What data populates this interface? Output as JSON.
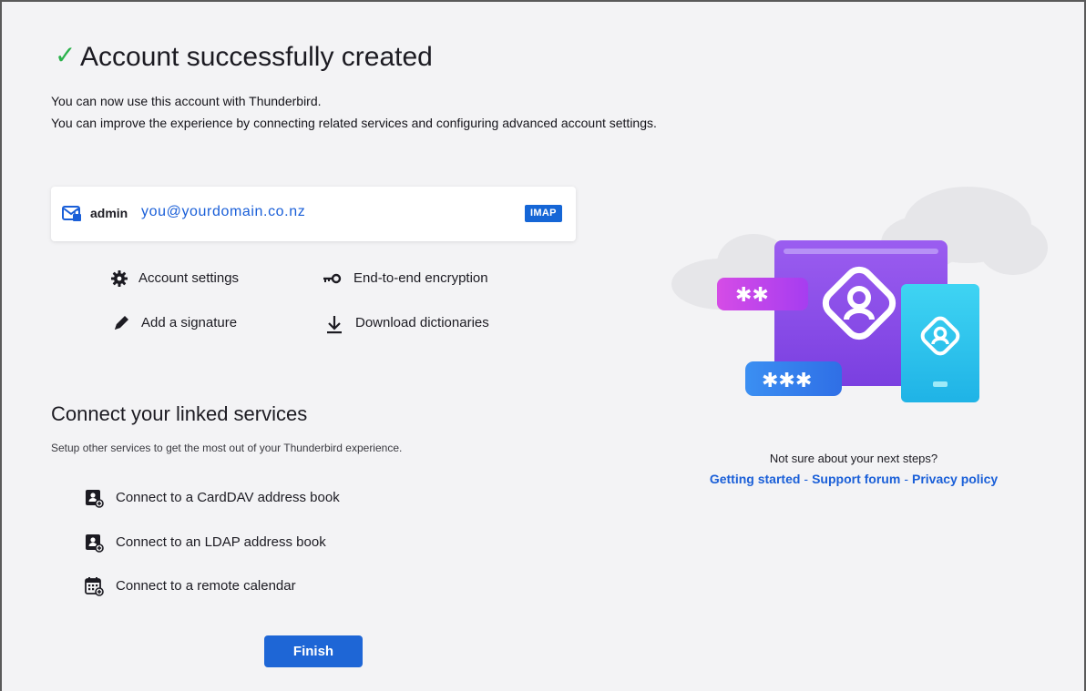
{
  "header": {
    "check_glyph": "✓",
    "title": "Account successfully created",
    "line1": "You can now use this account with Thunderbird.",
    "line2": "You can improve the experience by connecting related services and configuring advanced account settings."
  },
  "account": {
    "name": "admin",
    "email": "you@yourdomain.co.nz",
    "protocol": "IMAP",
    "icon": "mail-icon"
  },
  "actions": [
    {
      "label": "Account settings",
      "icon": "gear-icon"
    },
    {
      "label": "End-to-end encryption",
      "icon": "key-icon"
    },
    {
      "label": "Add a signature",
      "icon": "pen-icon"
    },
    {
      "label": "Download dictionaries",
      "icon": "download-icon"
    }
  ],
  "linked": {
    "title": "Connect your linked services",
    "subtitle": "Setup other services to get the most out of your Thunderbird experience.",
    "services": [
      {
        "label": "Connect to a CardDAV address book",
        "icon": "address-book-icon"
      },
      {
        "label": "Connect to an LDAP address book",
        "icon": "address-book-icon"
      },
      {
        "label": "Connect to a remote calendar",
        "icon": "calendar-icon"
      }
    ]
  },
  "finish_label": "Finish",
  "help": {
    "question": "Not sure about your next steps?",
    "links": [
      "Getting started",
      "Support forum",
      "Privacy policy"
    ],
    "separator": "-"
  },
  "illustration": {
    "password_short": "✱✱",
    "password_long": "✱✱✱"
  },
  "colors": {
    "accent": "#1e66d6",
    "link": "#1a5fd8",
    "success": "#2bb24c",
    "badge": "#1566d6"
  }
}
